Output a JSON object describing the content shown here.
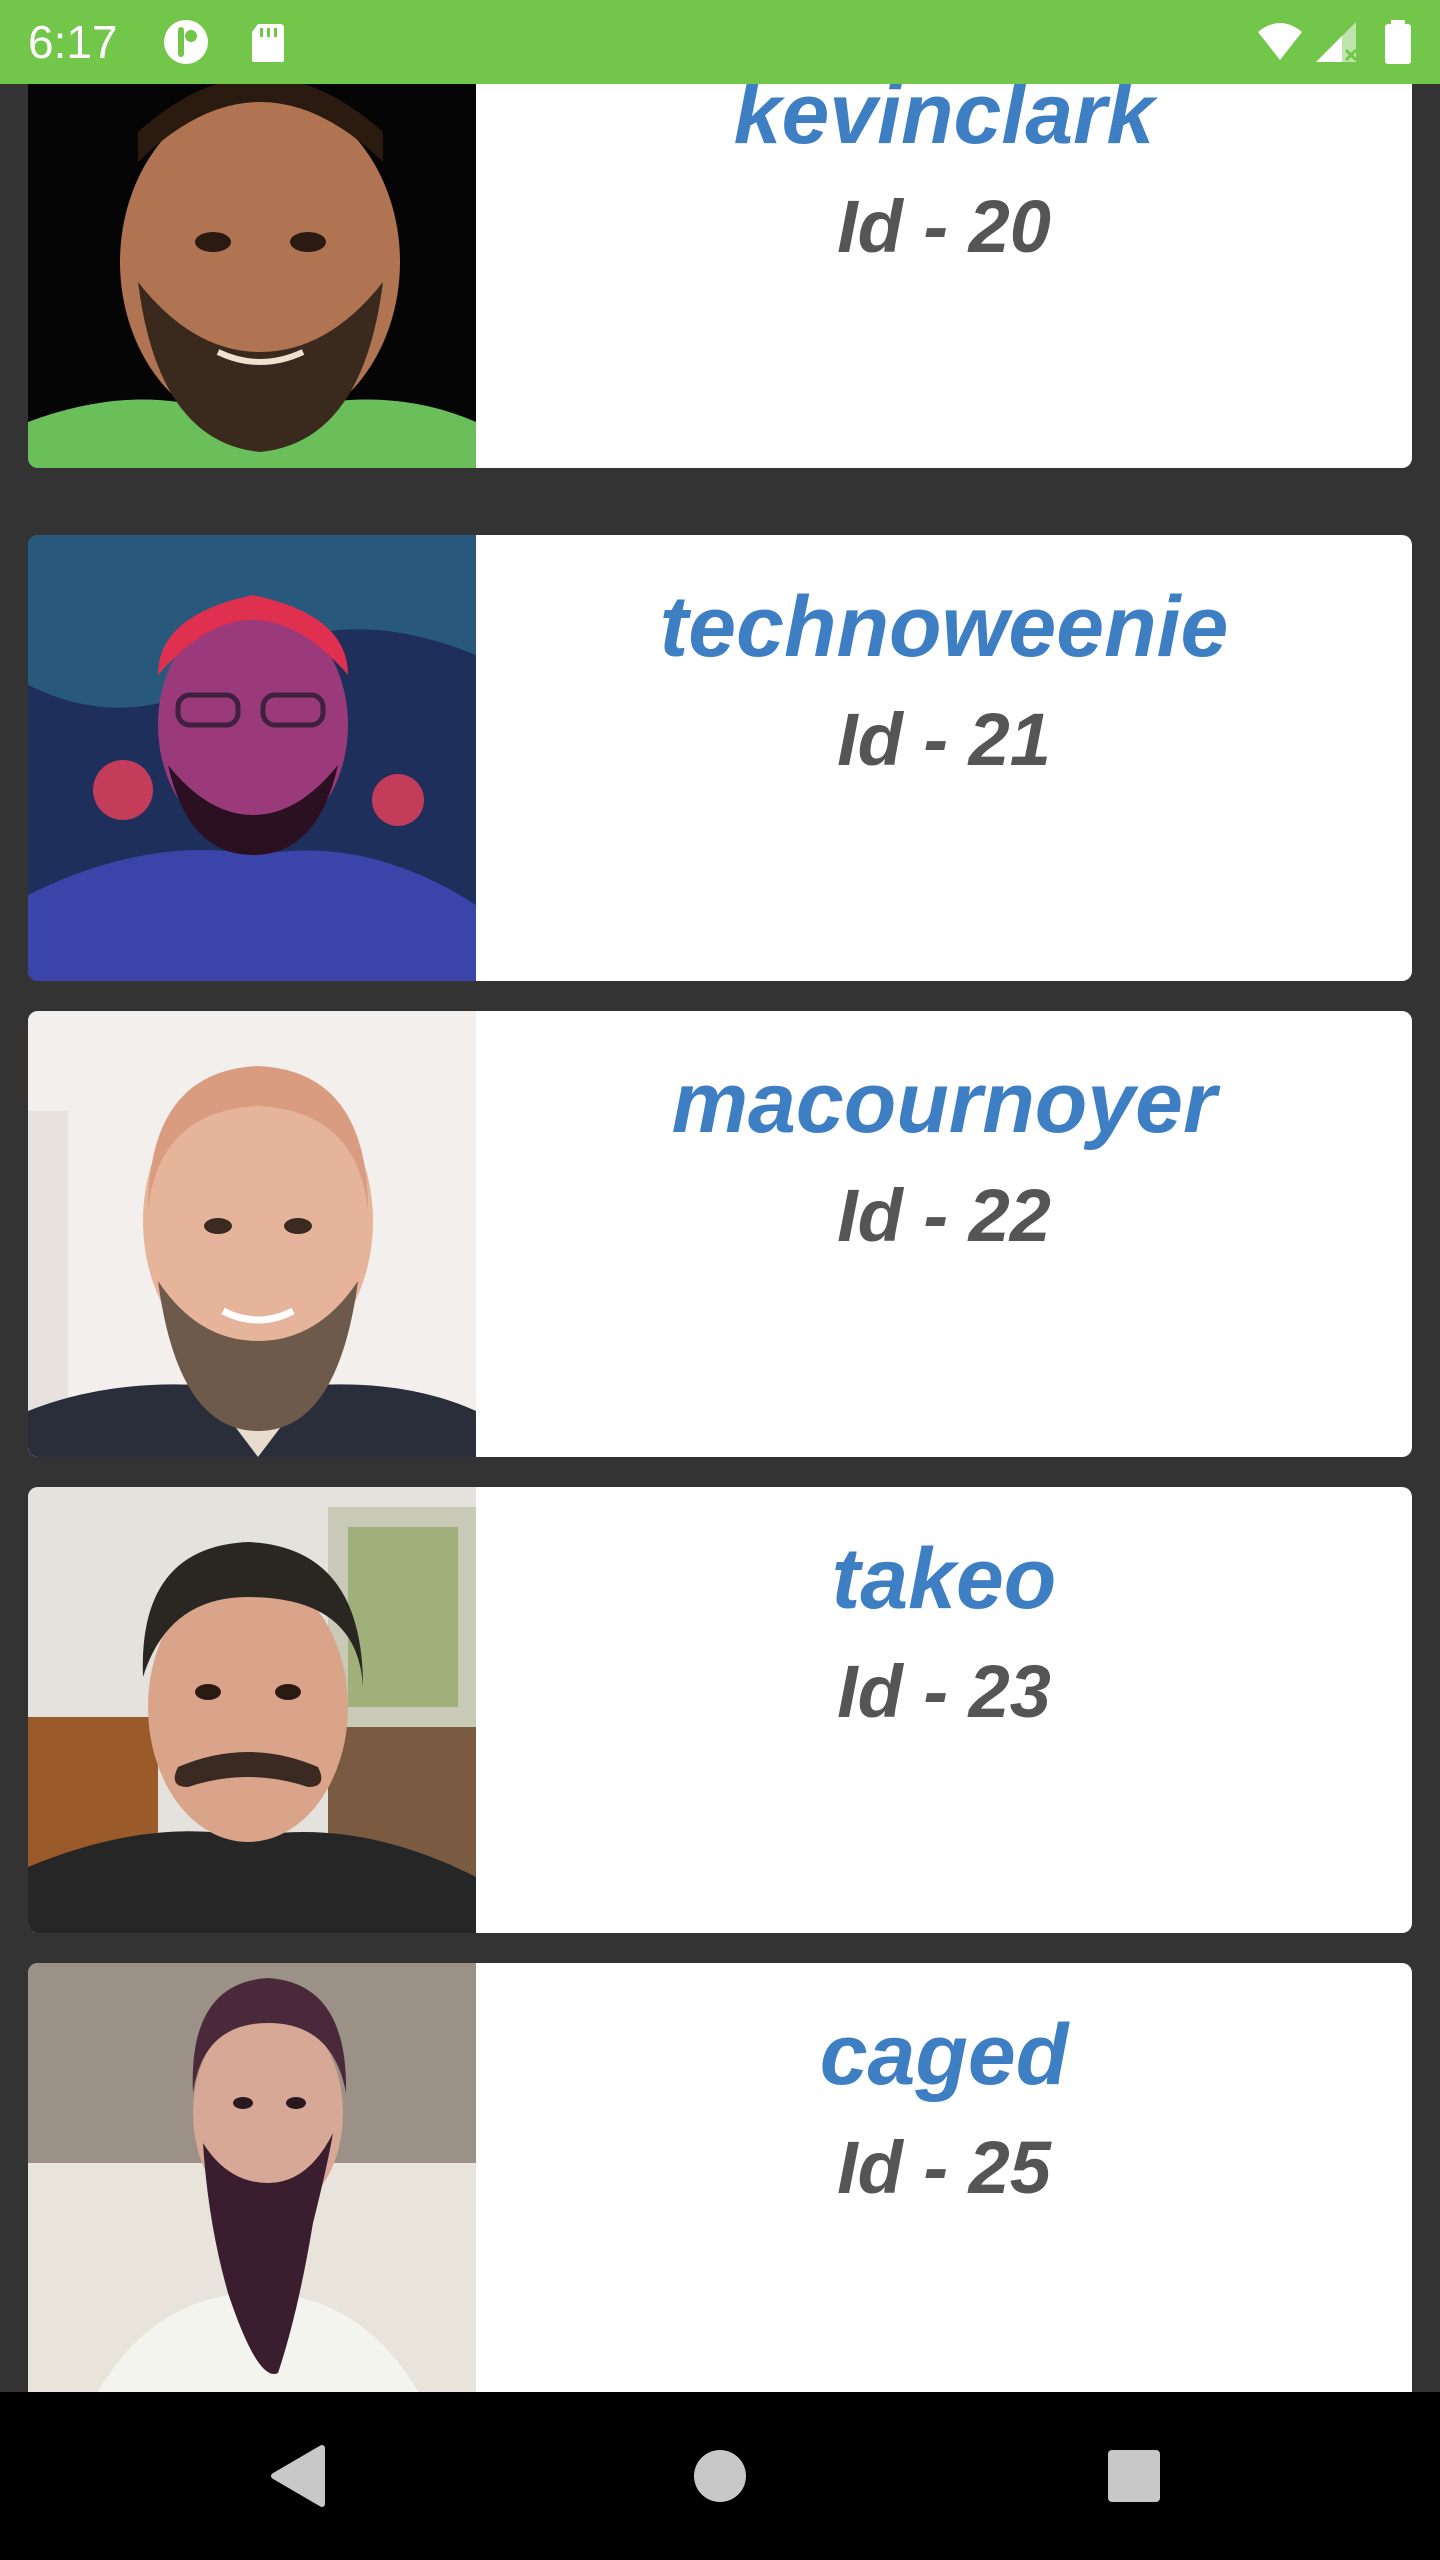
{
  "status_bar": {
    "time": "6:17",
    "background_color": "#72c64a",
    "icons": [
      "notification-app-icon",
      "sd-card-icon",
      "wifi-icon",
      "cellular-signal-icon",
      "battery-icon"
    ]
  },
  "users": [
    {
      "username": "kevinclark",
      "id_label": "Id - 20"
    },
    {
      "username": "technoweenie",
      "id_label": "Id - 21"
    },
    {
      "username": "macournoyer",
      "id_label": "Id - 22"
    },
    {
      "username": "takeo",
      "id_label": "Id - 23"
    },
    {
      "username": "caged",
      "id_label": "Id - 25"
    }
  ],
  "colors": {
    "username": "#3e7fc4",
    "id_text": "#555555",
    "list_background": "#333333",
    "card_background": "#ffffff"
  },
  "nav_bar": {
    "icons": [
      "back-icon",
      "home-icon",
      "recents-icon"
    ]
  }
}
